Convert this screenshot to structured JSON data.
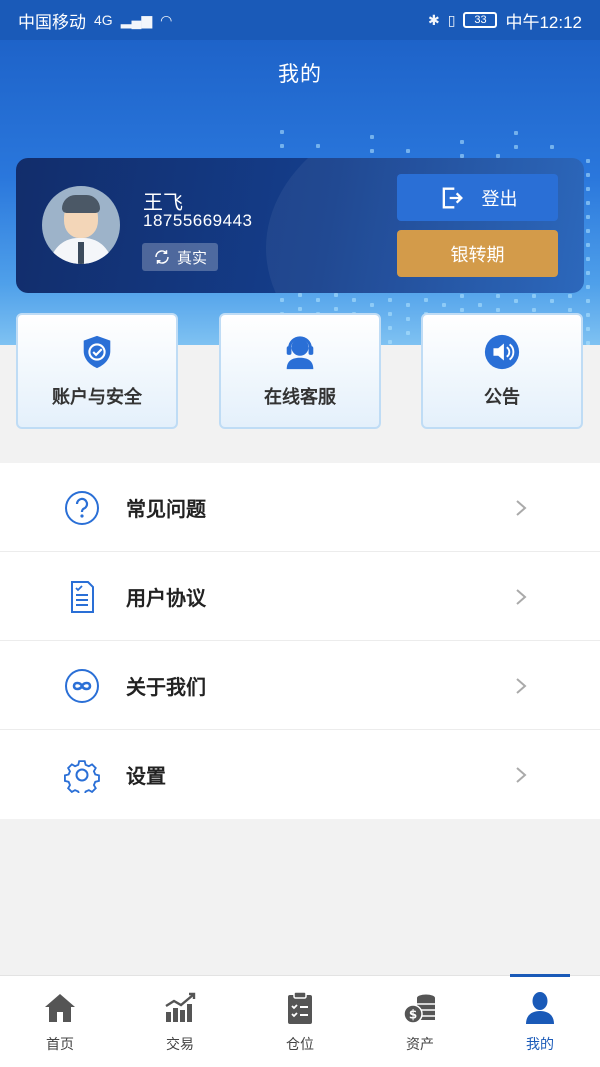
{
  "status_bar": {
    "carrier": "中国移动",
    "network": "4G",
    "battery": "33",
    "time": "中午12:12"
  },
  "header": {
    "title": "我的"
  },
  "profile": {
    "name": "王飞",
    "phone": "18755669443",
    "verify_badge": "真实",
    "logout_label": "登出",
    "bank_transfer_label": "银转期"
  },
  "quick_actions": [
    {
      "label": "账户与安全",
      "icon": "shield-check-icon"
    },
    {
      "label": "在线客服",
      "icon": "headset-icon"
    },
    {
      "label": "公告",
      "icon": "speaker-icon"
    }
  ],
  "menu": [
    {
      "label": "常见问题",
      "icon": "question-circle-icon"
    },
    {
      "label": "用户协议",
      "icon": "document-icon"
    },
    {
      "label": "关于我们",
      "icon": "infinity-circle-icon"
    },
    {
      "label": "设置",
      "icon": "gear-icon"
    }
  ],
  "tabs": [
    {
      "label": "首页",
      "icon": "home-icon"
    },
    {
      "label": "交易",
      "icon": "chart-icon"
    },
    {
      "label": "仓位",
      "icon": "clipboard-icon"
    },
    {
      "label": "资产",
      "icon": "coins-icon"
    },
    {
      "label": "我的",
      "icon": "user-icon",
      "active": true
    }
  ],
  "colors": {
    "primary": "#1a5ab8",
    "gold": "#d39b4a",
    "icon_blue": "#2a6fd6",
    "tab_gray": "#555555"
  }
}
